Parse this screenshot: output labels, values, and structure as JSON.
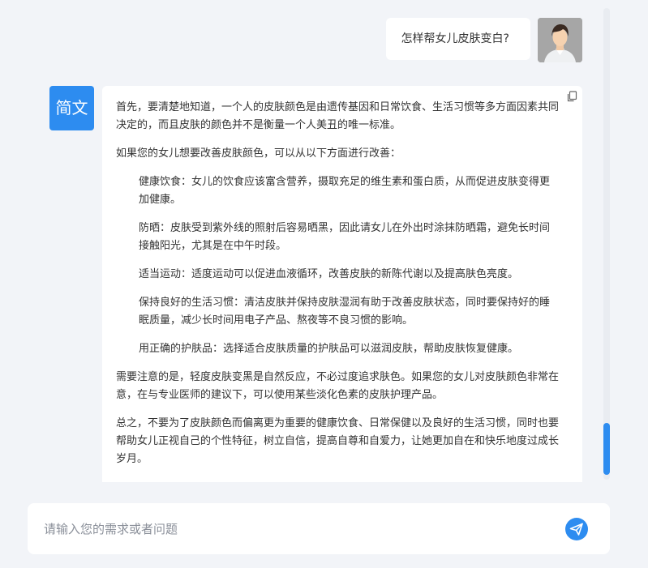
{
  "user_message": "怎样帮女儿皮肤变白?",
  "bot_avatar_label": "简文",
  "icons": {
    "copy": "copy-icon",
    "send": "send-icon",
    "user_avatar": "user-avatar-icon"
  },
  "bot_response": {
    "paragraphs": [
      {
        "text": "首先，要清楚地知道，一个人的皮肤颜色是由遗传基因和日常饮食、生活习惯等多方面因素共同决定的，而且皮肤的颜色并不是衡量一个人美丑的唯一标准。",
        "indent": false
      },
      {
        "text": "如果您的女儿想要改善皮肤颜色，可以从以下方面进行改善：",
        "indent": false
      },
      {
        "text": "健康饮食：女儿的饮食应该富含营养，摄取充足的维生素和蛋白质，从而促进皮肤变得更加健康。",
        "indent": true
      },
      {
        "text": "防晒：皮肤受到紫外线的照射后容易晒黑，因此请女儿在外出时涂抹防晒霜，避免长时间接触阳光，尤其是在中午时段。",
        "indent": true
      },
      {
        "text": "适当运动：适度运动可以促进血液循环，改善皮肤的新陈代谢以及提高肤色亮度。",
        "indent": true
      },
      {
        "text": "保持良好的生活习惯：清洁皮肤并保持皮肤湿润有助于改善皮肤状态，同时要保持好的睡眠质量，减少长时间用电子产品、熬夜等不良习惯的影响。",
        "indent": true
      },
      {
        "text": "用正确的护肤品：选择适合皮肤质量的护肤品可以滋润皮肤，帮助皮肤恢复健康。",
        "indent": true
      },
      {
        "text": "需要注意的是，轻度皮肤变黑是自然反应，不必过度追求肤色。如果您的女儿对皮肤颜色非常在意，在与专业医师的建议下，可以使用某些淡化色素的皮肤护理产品。",
        "indent": false
      },
      {
        "text": "总之，不要为了皮肤颜色而偏离更为重要的健康饮食、日常保健以及良好的生活习惯，同时也要帮助女儿正视自己的个性特征，树立自信，提高自尊和自爱力，让她更加自在和快乐地度过成长岁月。",
        "indent": false
      }
    ]
  },
  "input": {
    "placeholder": "请输入您的需求或者问题",
    "value": ""
  },
  "colors": {
    "accent": "#2d8cf0",
    "background": "#f2f4f8",
    "bubble": "#ffffff"
  }
}
